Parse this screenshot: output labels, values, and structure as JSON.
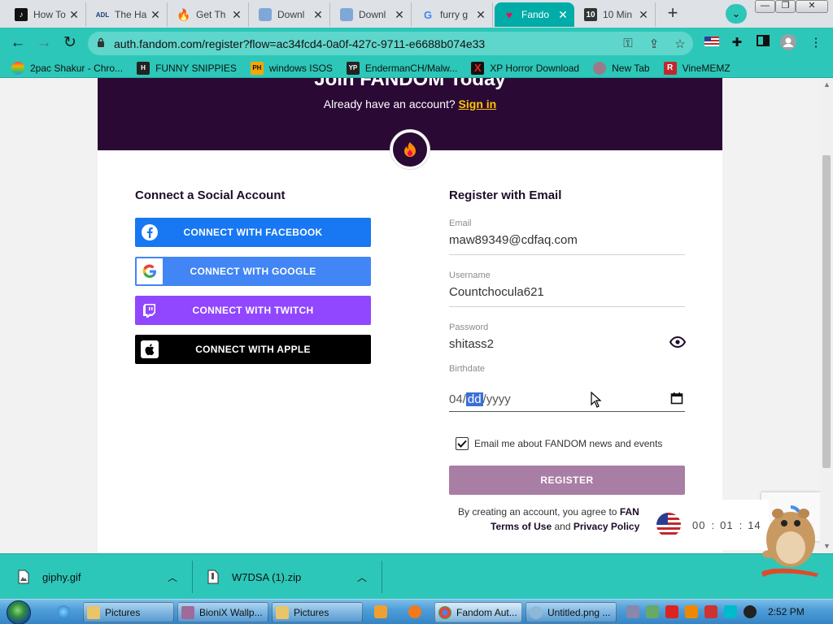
{
  "browser": {
    "tabs": [
      {
        "title": "How To",
        "icon": "tiktok-icon"
      },
      {
        "title": "The Ha",
        "icon": "adl-icon"
      },
      {
        "title": "Get Th",
        "icon": "flame-icon"
      },
      {
        "title": "Downl",
        "icon": "web-icon"
      },
      {
        "title": "Downl",
        "icon": "web-icon"
      },
      {
        "title": "furry g",
        "icon": "google-icon"
      },
      {
        "title": "Fando",
        "icon": "fandom-icon"
      },
      {
        "title": "10 Min",
        "icon": "tenminute-icon"
      }
    ],
    "url": "auth.fandom.com/register?flow=ac34fcd4-0a0f-427c-9711-e6688b074e33",
    "bookmarks": [
      {
        "label": "2pac Shakur - Chro...",
        "icon": "rainbow-icon"
      },
      {
        "label": "FUNNY SNIPPIES",
        "icon": "h-icon"
      },
      {
        "label": "windows ISOS",
        "icon": "ph-icon"
      },
      {
        "label": "EndermanCH/Malw...",
        "icon": "yp-icon"
      },
      {
        "label": "XP Horror Download",
        "icon": "x-icon"
      },
      {
        "label": "New Tab",
        "icon": "newtab-icon"
      },
      {
        "label": "VineMEMZ",
        "icon": "r-icon"
      }
    ]
  },
  "page": {
    "hero_cut_text": "Join FANDOM Today",
    "already_text": "Already have an account?",
    "sign_in": "Sign in",
    "social_heading": "Connect a Social Account",
    "social_buttons": {
      "facebook": "CONNECT WITH FACEBOOK",
      "google": "CONNECT WITH GOOGLE",
      "twitch": "CONNECT WITH TWITCH",
      "apple": "CONNECT WITH APPLE"
    },
    "email_heading": "Register with Email",
    "email_label": "Email",
    "email_value": "maw89349@cdfaq.com",
    "username_label": "Username",
    "username_value": "Countchocula621",
    "password_label": "Password",
    "password_value": "shitass2",
    "birthdate_label": "Birthdate",
    "birth_month": "04",
    "birth_day": "dd",
    "birth_year": "yyyy",
    "birth_sep": "/",
    "newsletter_label": "Email me about FANDOM news and events",
    "newsletter_checked": true,
    "register_label": "REGISTER",
    "terms_prefix": "By creating an account, you agree to",
    "terms_brand": "FAN",
    "terms_of_use": "Terms of Use",
    "terms_and": "and",
    "privacy": "Privacy Policy",
    "timer": {
      "h": "00",
      "m": "01",
      "s": "14"
    },
    "colors": {
      "hero": "#2a0a35",
      "accent_link": "#ffc500",
      "register_btn": "#a97ea4",
      "facebook": "#1877f2",
      "google": "#4285f4",
      "twitch": "#9146ff",
      "apple": "#000000"
    }
  },
  "downloads": [
    {
      "name": "giphy.gif"
    },
    {
      "name": "W7DSA (1).zip"
    }
  ],
  "taskbar": {
    "items": [
      {
        "label": "Pictures"
      },
      {
        "label": "BioniX Wallp..."
      },
      {
        "label": "Pictures"
      },
      {
        "label": "Fandom Aut..."
      },
      {
        "label": "Untitled.png ..."
      }
    ],
    "clock": "2:52 PM"
  }
}
